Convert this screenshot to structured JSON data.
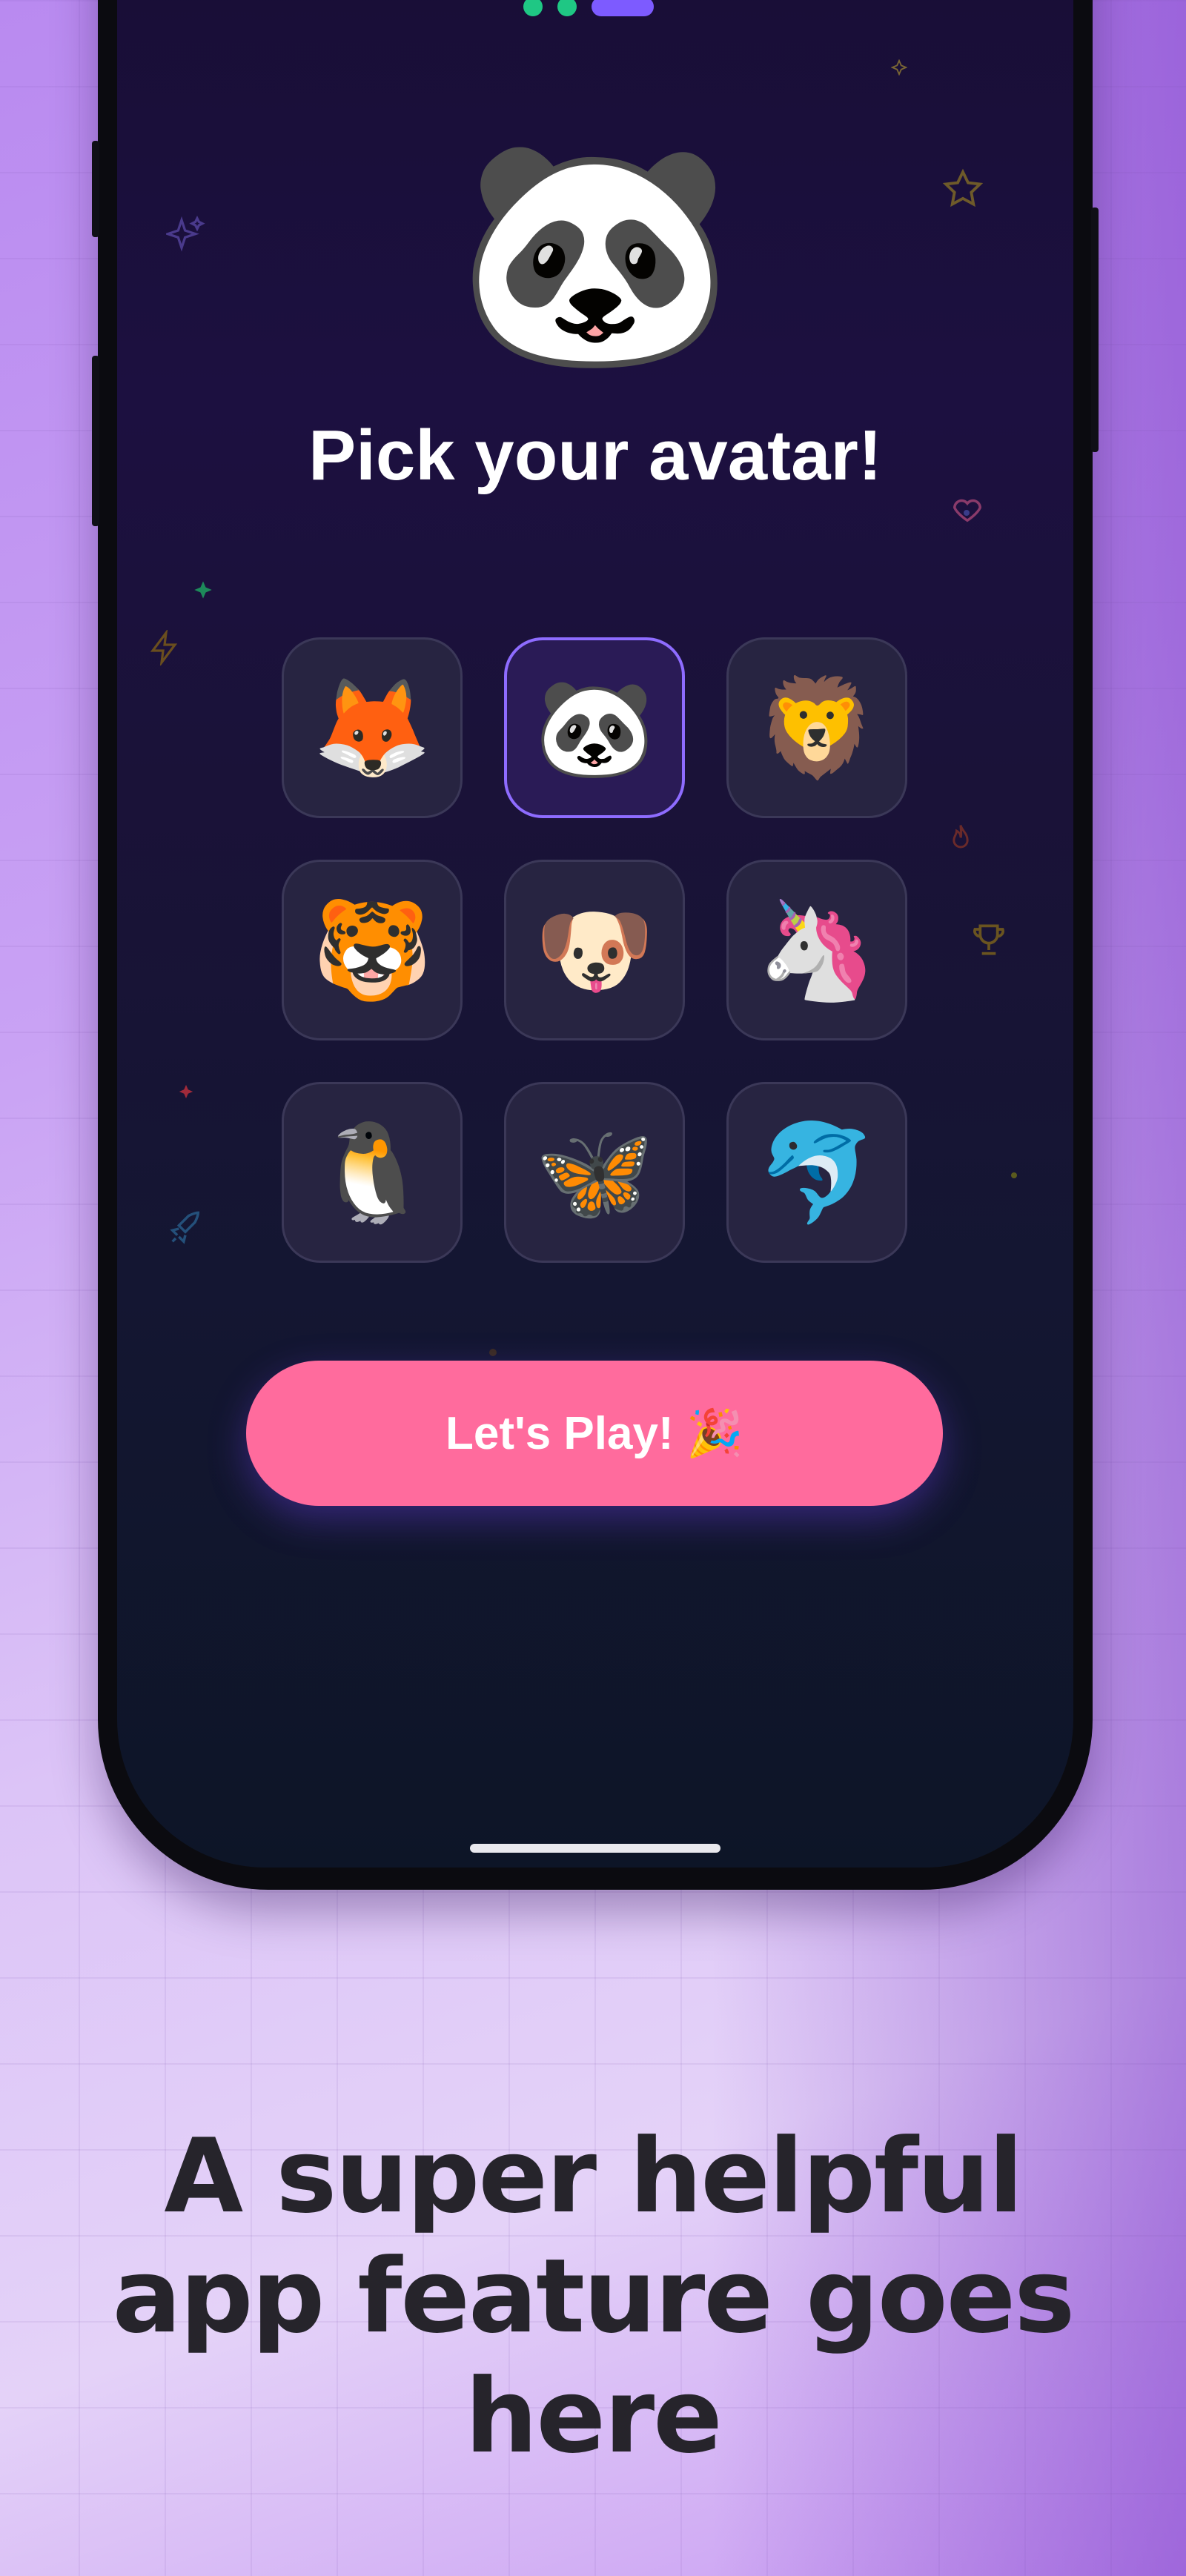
{
  "colors": {
    "accent": "#7d5bff",
    "button": "#ff6b9d",
    "page_dot_active": "#1fc784",
    "selected_border": "#8e6cff",
    "screen_bg": "#1a1238"
  },
  "pager": {
    "dots": 2,
    "active_index": 2
  },
  "screen": {
    "hero_avatar": "🐼",
    "title": "Pick your avatar!",
    "avatars": [
      {
        "emoji": "🦊",
        "name": "fox-avatar",
        "selected": false
      },
      {
        "emoji": "🐼",
        "name": "panda-avatar",
        "selected": true
      },
      {
        "emoji": "🦁",
        "name": "lion-avatar",
        "selected": false
      },
      {
        "emoji": "🐯",
        "name": "tiger-avatar",
        "selected": false
      },
      {
        "emoji": "🐶",
        "name": "dog-avatar",
        "selected": false
      },
      {
        "emoji": "🦄",
        "name": "unicorn-avatar",
        "selected": false
      },
      {
        "emoji": "🐧",
        "name": "penguin-avatar",
        "selected": false
      },
      {
        "emoji": "🦋",
        "name": "butterfly-avatar",
        "selected": false
      },
      {
        "emoji": "🐬",
        "name": "dolphin-avatar",
        "selected": false
      }
    ],
    "play_button_label": "Let's Play! 🎉"
  },
  "caption": "A super helpful app feature goes here",
  "icons": [
    "sparkle-icon",
    "star-icon",
    "heart-icon",
    "bolt-icon",
    "flame-icon",
    "trophy-icon",
    "rocket-icon"
  ]
}
